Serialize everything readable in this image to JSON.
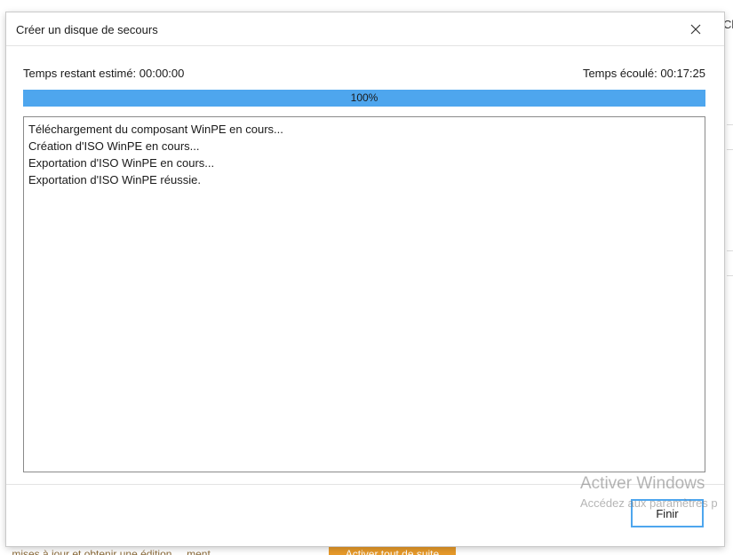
{
  "background": {
    "right_edge_text": "Cl",
    "bottom_text": "... mises à jour et obtenir une édition ... ment",
    "bottom_button_label": "Activer tout de suite"
  },
  "dialog": {
    "title": "Créer un disque de secours",
    "close_icon": "close-icon",
    "time_remaining": "Temps restant estimé: 00:00:00",
    "time_elapsed": "Temps écoulé: 00:17:25",
    "progress": {
      "percent": 100,
      "label": "100%",
      "color": "#4ea6ee"
    },
    "log": [
      "Téléchargement du composant WinPE en cours...",
      "Création d'ISO WinPE en cours...",
      "Exportation d'ISO WinPE en cours...",
      "Exportation d'ISO WinPE réussie."
    ],
    "finish_label": "Finir"
  },
  "watermark": {
    "title": "Activer Windows",
    "subtitle": "Accédez aux paramètres p"
  }
}
